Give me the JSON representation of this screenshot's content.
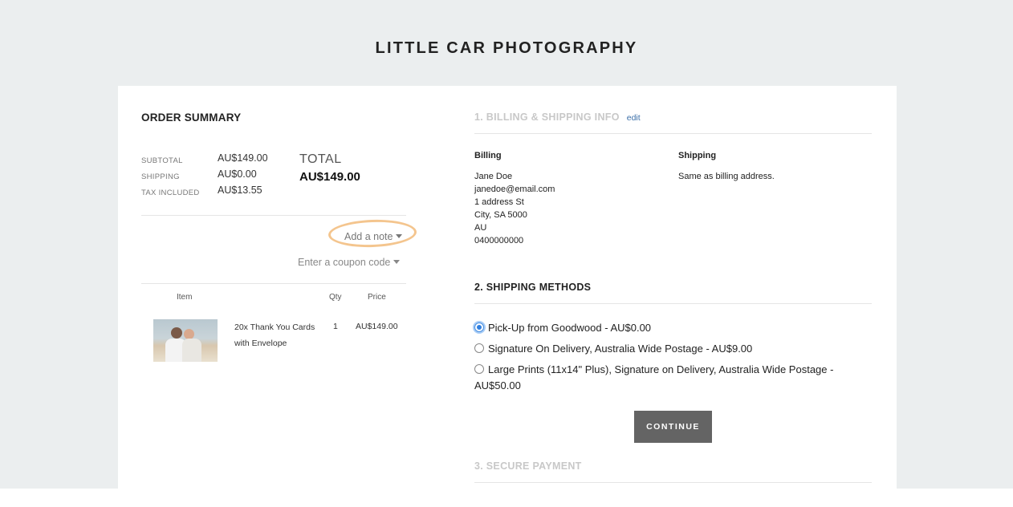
{
  "site": {
    "title": "LITTLE CAR PHOTOGRAPHY"
  },
  "order_summary": {
    "title": "ORDER SUMMARY",
    "rows": [
      {
        "label": "SUBTOTAL",
        "value": "AU$149.00"
      },
      {
        "label": "SHIPPING",
        "value": "AU$0.00"
      },
      {
        "label": "TAX INCLUDED",
        "value": "AU$13.55"
      }
    ],
    "total_label": "TOTAL",
    "total_value": "AU$149.00",
    "add_note": "Add a note",
    "coupon": "Enter a coupon code",
    "table_headers": {
      "item": "Item",
      "qty": "Qty",
      "price": "Price"
    },
    "items": [
      {
        "name": "20x Thank You Cards with Envelope",
        "qty": "1",
        "price": "AU$149.00"
      }
    ]
  },
  "billing": {
    "title": "1. BILLING & SHIPPING INFO",
    "edit": "edit",
    "billing_heading": "Billing",
    "billing_lines": [
      "Jane Doe",
      "janedoe@email.com",
      "1 address St",
      "City, SA 5000",
      "AU",
      "0400000000"
    ],
    "shipping_heading": "Shipping",
    "shipping_text": "Same as billing address."
  },
  "shipping_methods": {
    "title": "2. SHIPPING METHODS",
    "options": [
      {
        "label": "Pick-Up from Goodwood - AU$0.00",
        "selected": true
      },
      {
        "label": "Signature On Delivery, Australia Wide Postage - AU$9.00",
        "selected": false
      },
      {
        "label": "Large Prints (11x14\" Plus), Signature on Delivery, Australia Wide Postage - AU$50.00",
        "selected": false
      }
    ],
    "continue": "CONTINUE"
  },
  "payment": {
    "title": "3. SECURE PAYMENT"
  },
  "colors": {
    "highlight": "#f4c58e",
    "link": "#3b6fa8",
    "button": "#646464",
    "radio_selected": "#2f7fe0"
  }
}
